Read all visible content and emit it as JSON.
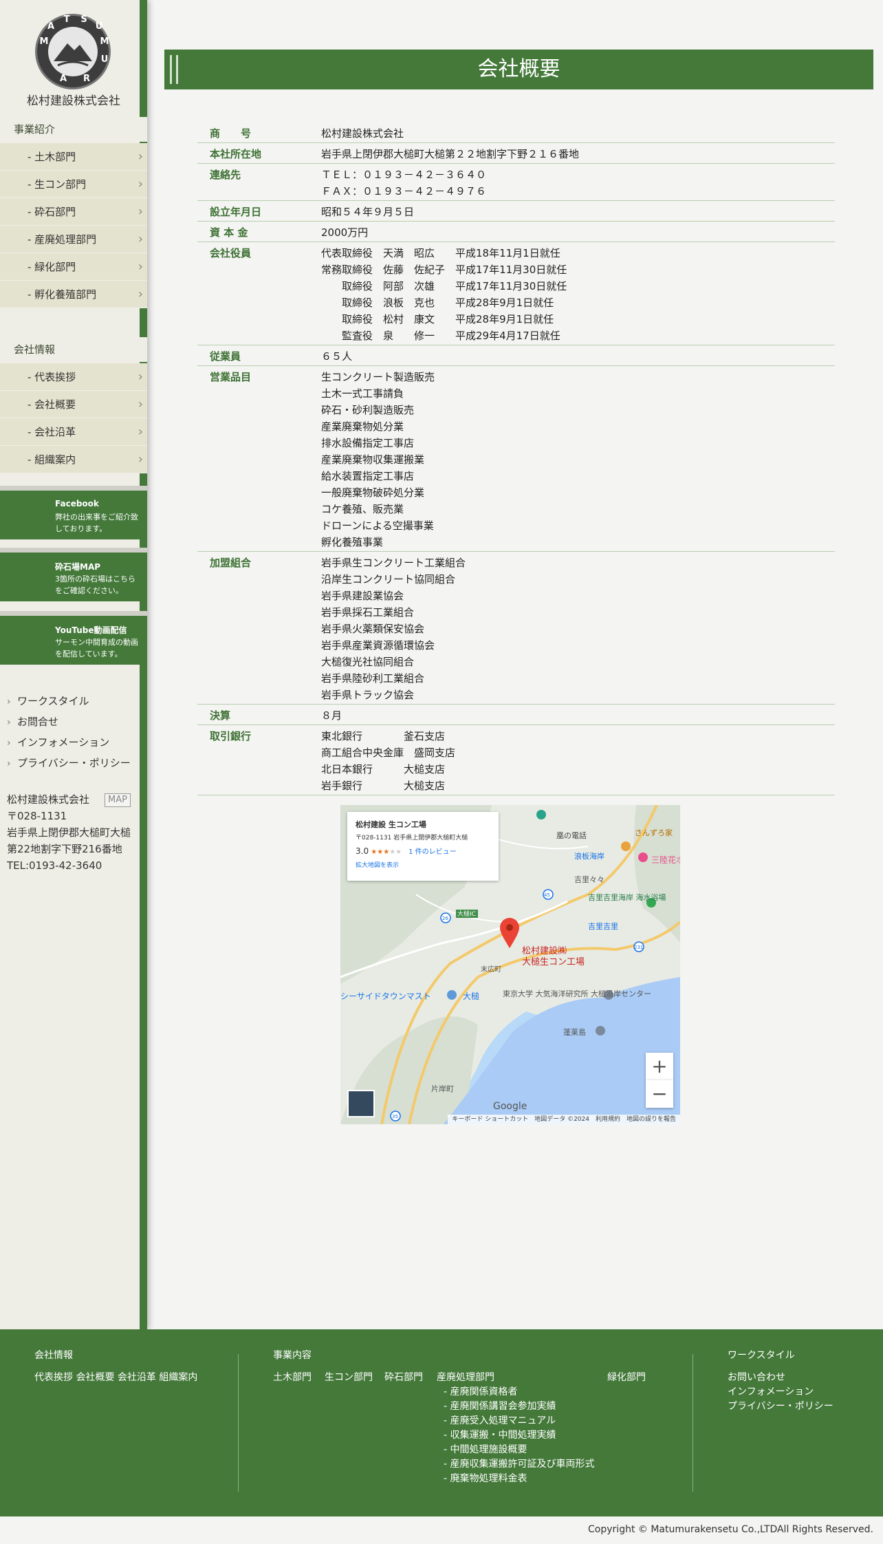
{
  "brand": {
    "name": "松村建設株式会社",
    "logo_letters": [
      "M",
      "A",
      "T",
      "S",
      "U",
      "M",
      "U",
      "R",
      "A"
    ]
  },
  "sidebar": {
    "section1": {
      "title": "事業紹介",
      "items": [
        "- 土木部門",
        "- 生コン部門",
        "- 砕石部門",
        "- 産廃処理部門",
        "- 緑化部門",
        "- 孵化養殖部門"
      ]
    },
    "section2": {
      "title": "会社情報",
      "items": [
        "- 代表挨拶",
        "- 会社概要",
        "- 会社沿革",
        "- 組織案内"
      ]
    },
    "banners": [
      {
        "title": "Facebook",
        "desc": "弊社の出来事をご紹介致しております。"
      },
      {
        "title": "砕石場MAP",
        "desc": "3箇所の砕石場はこちらをご確認ください。"
      },
      {
        "title": "YouTube動画配信",
        "desc": "サーモン中間育成の動画を配信しています。"
      }
    ],
    "links": [
      "ワークスタイル",
      "お問合せ",
      "インフォメーション",
      "プライバシー・ポリシー"
    ],
    "address": {
      "company": "松村建設株式会社",
      "map_label": "MAP",
      "zip": "〒028-1131",
      "line1": "岩手県上閉伊郡大槌町大槌",
      "line2": "第22地割字下野216番地",
      "tel": "TEL:0193-42-3640"
    }
  },
  "main": {
    "title": "会社概要",
    "rows": [
      {
        "label": "商　　号",
        "lines": [
          "松村建設株式会社"
        ]
      },
      {
        "label": "本社所在地",
        "lines": [
          "岩手県上閉伊郡大槌町大槌第２２地割字下野２１６番地"
        ]
      },
      {
        "label": "連絡先",
        "lines": [
          "ＴＥＬ：０１９３－４２－３６４０",
          "ＦＡＸ：０１９３－４２－４９７６"
        ]
      },
      {
        "label": "設立年月日",
        "lines": [
          "昭和５４年９月５日"
        ]
      },
      {
        "label": "資 本 金",
        "lines": [
          "2000万円"
        ]
      },
      {
        "label": "会社役員",
        "lines": [
          "代表取締役　天満　昭広　　平成18年11月1日就任",
          "常務取締役　佐藤　佐紀子　平成17年11月30日就任",
          "　　取締役　阿部　次雄　　平成17年11月30日就任",
          "　　取締役　浪板　克也　　平成28年9月1日就任",
          "　　取締役　松村　康文　　平成28年9月1日就任",
          "　　監査役　泉　　修一　　平成29年4月17日就任"
        ]
      },
      {
        "label": "従業員",
        "lines": [
          "６５人"
        ]
      },
      {
        "label": "営業品目",
        "lines": [
          "生コンクリート製造販売",
          "土木一式工事請負",
          "砕石・砂利製造販売",
          "産業廃棄物処分業",
          "排水設備指定工事店",
          "産業廃棄物収集運搬業",
          "給水装置指定工事店",
          "一般廃棄物破砕処分業",
          "コケ養殖、販売業",
          "ドローンによる空撮事業",
          "孵化養殖事業"
        ]
      },
      {
        "label": "加盟組合",
        "lines": [
          "岩手県生コンクリート工業組合",
          "沿岸生コンクリート協同組合",
          "岩手県建設業協会",
          "岩手県採石工業組合",
          "岩手県火薬類保安協会",
          "岩手県産業資源循環協会",
          "大槌復光社協同組合",
          "岩手県陸砂利工業組合",
          "岩手県トラック協会"
        ]
      },
      {
        "label": "決算",
        "lines": [
          "８月"
        ]
      },
      {
        "label": "取引銀行",
        "lines": [
          "東北銀行　　　　釜石支店",
          "商工組合中央金庫　盛岡支店",
          "北日本銀行　　　大槌支店",
          "岩手銀行　　　　大槌支店"
        ]
      }
    ]
  },
  "map": {
    "popup": {
      "title": "松村建設 生コン工場",
      "address": "〒028-1131 岩手県上閉伊郡大槌町大槌",
      "rating": "3.0",
      "stars": "★★★",
      "stars_empty": "★★",
      "reviews": "1 件のレビュー",
      "link": "拡大地図を表示"
    },
    "pin_label": "松村建設㈱\n大槌生コン工場",
    "labels": {
      "l1": "三陸花ホテル",
      "l2": "浪板海岸",
      "l3": "吉里吉里海岸 海水浴場",
      "l4": "吉里吉里",
      "l5": "大槌IC",
      "l6": "末広町",
      "l7": "東京大学 大気海洋研究所 大槌沿岸センター",
      "l8": "蓬莱島",
      "l9": "シーサイドタウンマスト",
      "l10": "大槌",
      "l11": "片岸町",
      "l12": "凰の電話",
      "l13": "さんずろ家",
      "l14": "吉里々々"
    },
    "routes": [
      "45",
      "26",
      "231",
      "35"
    ],
    "zoom_in": "+",
    "zoom_out": "−",
    "google": "Google",
    "attribution": "キーボード ショートカット　地図データ ©2024　利用規約　地図の誤りを報告"
  },
  "footer": {
    "col1": {
      "title": "会社情報",
      "links": [
        "代表挨拶",
        "会社概要",
        "会社沿革",
        "組織案内"
      ]
    },
    "col2": {
      "title": "事業内容",
      "links": [
        "土木部門",
        "生コン部門",
        "砕石部門",
        "産廃処理部門",
        "緑化部門"
      ],
      "sublinks": [
        "- 産廃関係資格者",
        "- 産廃関係講習会参加実績",
        "- 産廃受入処理マニュアル",
        "- 収集運搬・中間処理実績",
        "- 中間処理施設概要",
        "- 産廃収集運搬許可証及び車両形式",
        "- 廃棄物処理料金表"
      ]
    },
    "col3": {
      "title": "ワークスタイル",
      "links": [
        "お問い合わせ",
        "インフォメーション",
        "プライバシー・ポリシー"
      ]
    }
  },
  "copyright": "Copyright © Matumurakensetu Co.,LTDAll Rights Reserved.",
  "colors": {
    "brand_green": "#44793a",
    "label_green": "#3d7133"
  }
}
